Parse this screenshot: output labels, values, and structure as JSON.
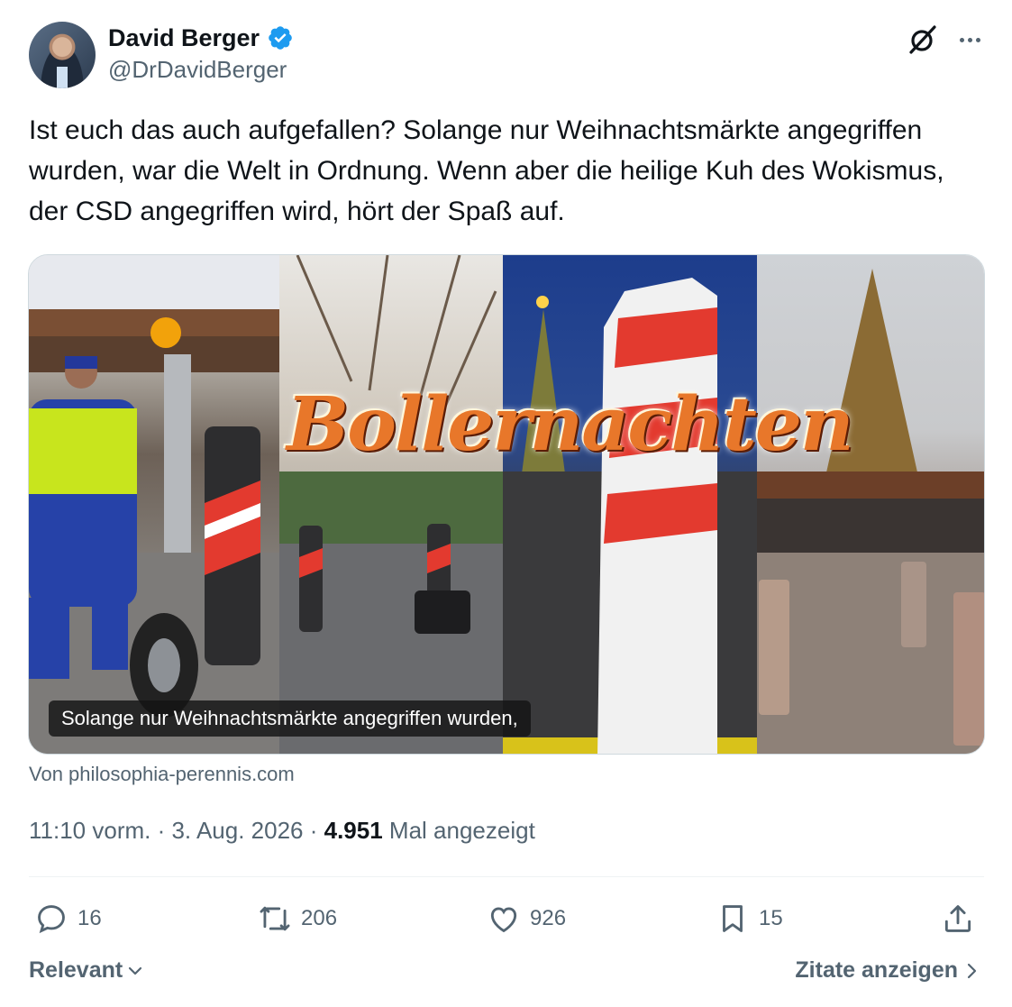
{
  "author": {
    "name": "David Berger",
    "handle": "@DrDavidBerger",
    "verified": true
  },
  "icons": {
    "verified": "verified-badge-icon",
    "grok": "grok-icon",
    "more": "more-icon"
  },
  "tweet": {
    "text": "Ist euch das auch aufgefallen? Solange nur Weihnachtsmärkte angegriffen wurden, war die Welt in Ordnung. Wenn aber die heilige Kuh des Wokismus, der CSD angegriffen wird, hört der Spaß auf."
  },
  "media": {
    "overlay_title": "Bollernachten",
    "caption": "Solange nur Weihnachtsmärkte angegriffen wurden,",
    "source": "Von philosophia-perennis.com"
  },
  "meta": {
    "time": "11:10 vorm.",
    "separator": " · ",
    "date": "3. Aug. 2026",
    "views": "4.951",
    "views_label": "Mal angezeigt"
  },
  "actions": {
    "replies": "16",
    "reposts": "206",
    "likes": "926",
    "bookmarks": "15"
  },
  "footer": {
    "sort_label": "Relevant",
    "quotes_label": "Zitate anzeigen"
  },
  "colors": {
    "text_primary": "#0f1419",
    "text_secondary": "#536471",
    "verified_blue": "#1d9bf0",
    "border": "#cfd9de"
  }
}
